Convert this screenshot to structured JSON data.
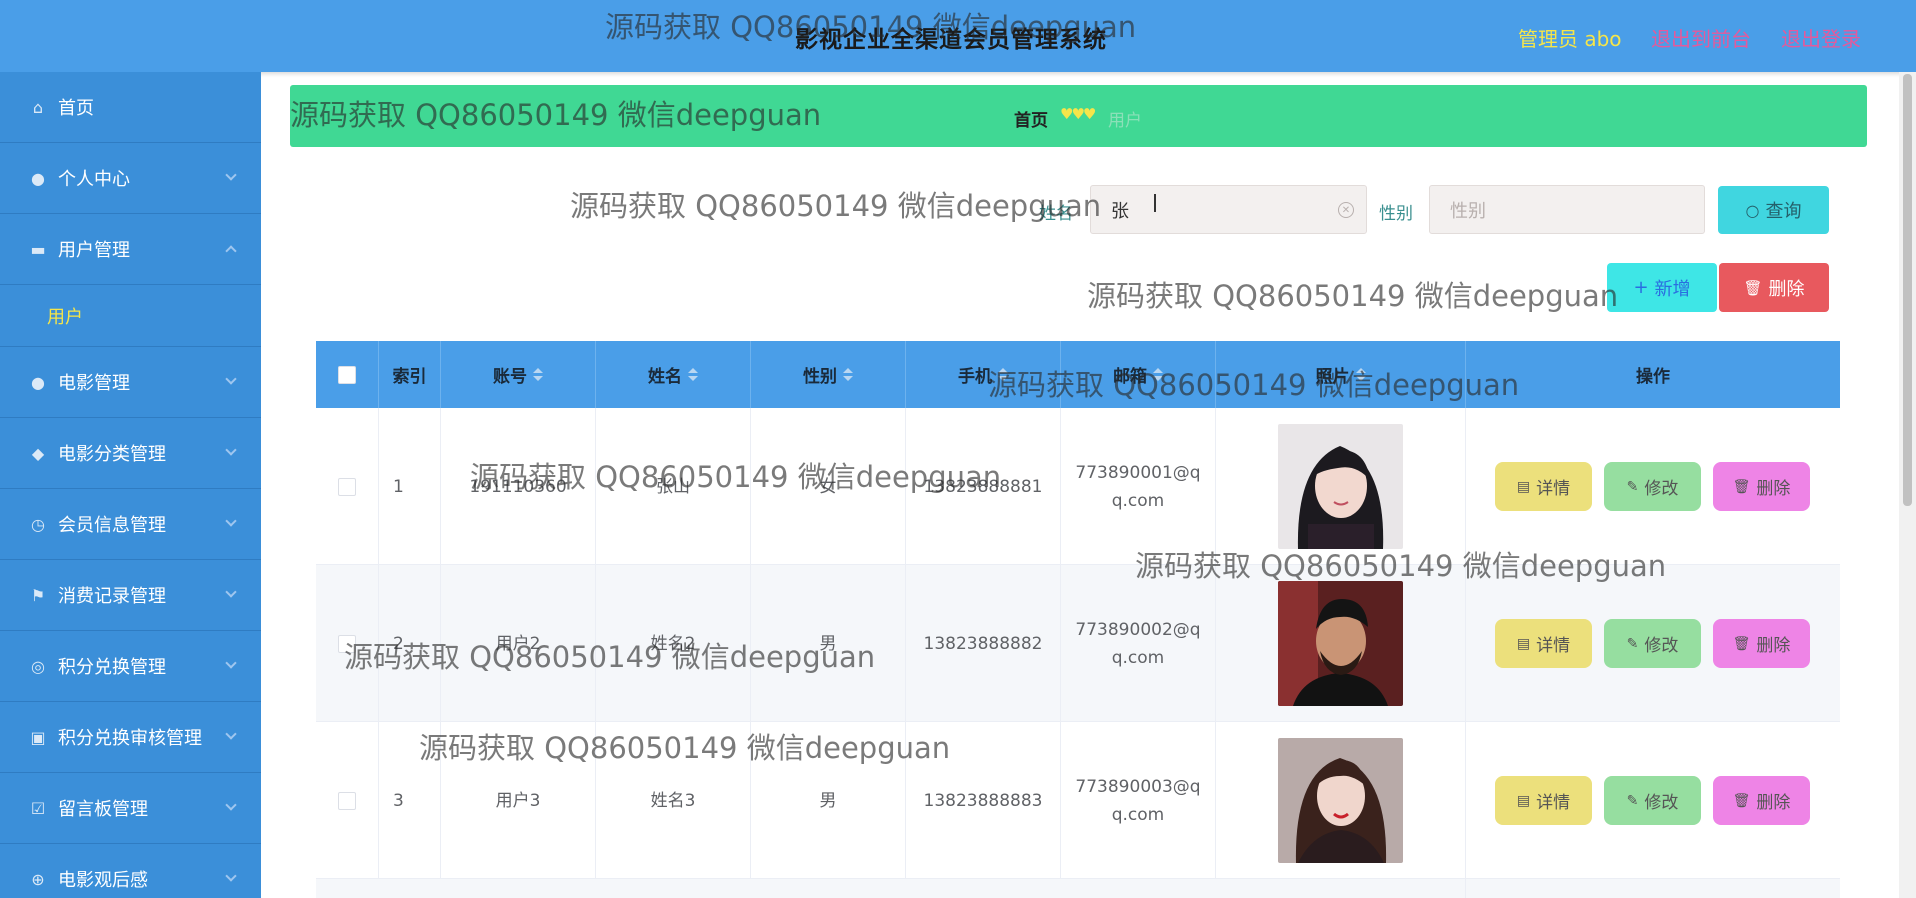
{
  "header": {
    "title": "影视企业全渠道会员管理系统",
    "admin": "管理员 abo",
    "to_front": "退出到前台",
    "logout": "退出登录"
  },
  "sidebar": {
    "items": [
      {
        "label": "首页",
        "icon": "home-icon"
      },
      {
        "label": "个人中心",
        "icon": "user-icon"
      },
      {
        "label": "用户管理",
        "icon": "chat-icon"
      },
      {
        "label": "电影管理",
        "icon": "user-icon"
      },
      {
        "label": "电影分类管理",
        "icon": "pin-icon"
      },
      {
        "label": "会员信息管理",
        "icon": "clock-icon"
      },
      {
        "label": "消费记录管理",
        "icon": "flag-icon"
      },
      {
        "label": "积分兑换管理",
        "icon": "circle-icon"
      },
      {
        "label": "积分兑换审核管理",
        "icon": "camera-icon"
      },
      {
        "label": "留言板管理",
        "icon": "check-square-icon"
      },
      {
        "label": "电影观后感",
        "icon": "target-icon"
      }
    ],
    "submenu": {
      "label": "用户"
    }
  },
  "breadcrumb": {
    "home": "首页",
    "hearts": "♥♥♥",
    "current": "用户"
  },
  "search": {
    "name_label": "姓名",
    "name_value": "张",
    "gender_label": "性别",
    "gender_placeholder": "性别",
    "query_label": "查询"
  },
  "actions": {
    "add_label": "新增",
    "delete_label": "删除"
  },
  "table": {
    "headers": [
      "索引",
      "账号",
      "姓名",
      "性别",
      "手机",
      "邮箱",
      "照片",
      "操作"
    ],
    "rows": [
      {
        "index": "1",
        "account": "191110360",
        "name": "张山",
        "gender": "女",
        "phone": "13823888881",
        "email_line1": "773890001@q",
        "email_line2": "q.com"
      },
      {
        "index": "2",
        "account": "用户2",
        "name": "姓名2",
        "gender": "男",
        "phone": "13823888882",
        "email_line1": "773890002@q",
        "email_line2": "q.com"
      },
      {
        "index": "3",
        "account": "用户3",
        "name": "姓名3",
        "gender": "男",
        "phone": "13823888883",
        "email_line1": "773890003@q",
        "email_line2": "q.com"
      }
    ],
    "row_actions": {
      "detail": "详情",
      "edit": "修改",
      "delete": "删除"
    }
  },
  "watermark": "源码获取 QQ86050149 微信deepguan",
  "colors": {
    "header_bg": "#4a9ee8",
    "sidebar_bg": "#3b8fd9",
    "breadcrumb_bg": "#40d894",
    "accent_yellow": "#f5e54a",
    "accent_pink": "#e45a9c"
  }
}
